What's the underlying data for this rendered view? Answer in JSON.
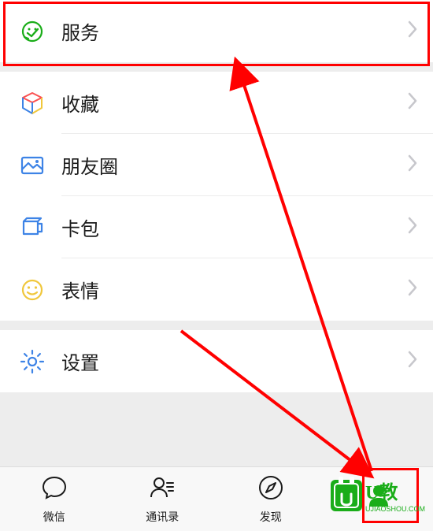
{
  "menu": {
    "service": {
      "label": "服务",
      "icon": "wechat-pay"
    },
    "favorites": {
      "label": "收藏",
      "icon": "cube"
    },
    "moments": {
      "label": "朋友圈",
      "icon": "photo"
    },
    "cards": {
      "label": "卡包",
      "icon": "wallet"
    },
    "stickers": {
      "label": "表情",
      "icon": "smile"
    },
    "settings": {
      "label": "设置",
      "icon": "gear"
    }
  },
  "tabs": {
    "chats": {
      "label": "微信"
    },
    "contacts": {
      "label": "通讯录"
    },
    "discover": {
      "label": "发现"
    },
    "me": {
      "label": ""
    }
  },
  "colors": {
    "annotation": "#ff0000",
    "icon_green": "#1aad19",
    "icon_orange": "#fa9d3b",
    "icon_blue": "#3d83e6",
    "icon_yellow": "#f0c73c"
  },
  "watermark": {
    "line1": "U教",
    "line2": "UJIAOSHOU.COM"
  }
}
